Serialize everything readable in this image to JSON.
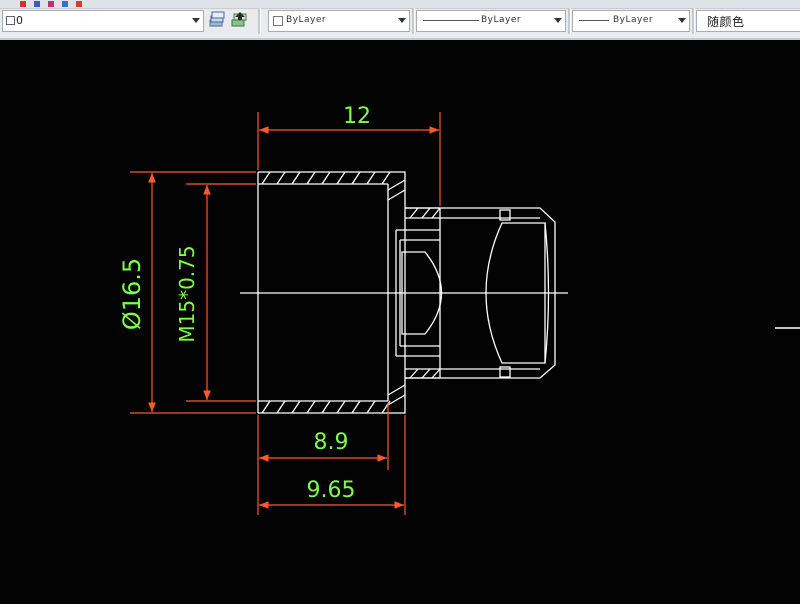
{
  "toolbar": {
    "layer_value": "0",
    "color_combo": "ByLayer",
    "linetype_combo": "ByLayer",
    "lineweight_combo": "ByLayer",
    "plotstyle_combo": "随颜色"
  },
  "icons": [
    "layer-square-icon",
    "layer-states-icon",
    "layer-match-icon",
    "dropdown-arrow-icon"
  ],
  "drawing": {
    "dimensions": {
      "top_length": "12",
      "outer_diameter": "Ø16.5",
      "thread": "M15*0.75",
      "inner_length": "8.9",
      "overall_length": "9.65"
    },
    "colors": {
      "background": "#030303",
      "outline": "#ffffff",
      "dimension_line": "#ff5a2a",
      "dimension_text": "#7cff4a"
    }
  }
}
